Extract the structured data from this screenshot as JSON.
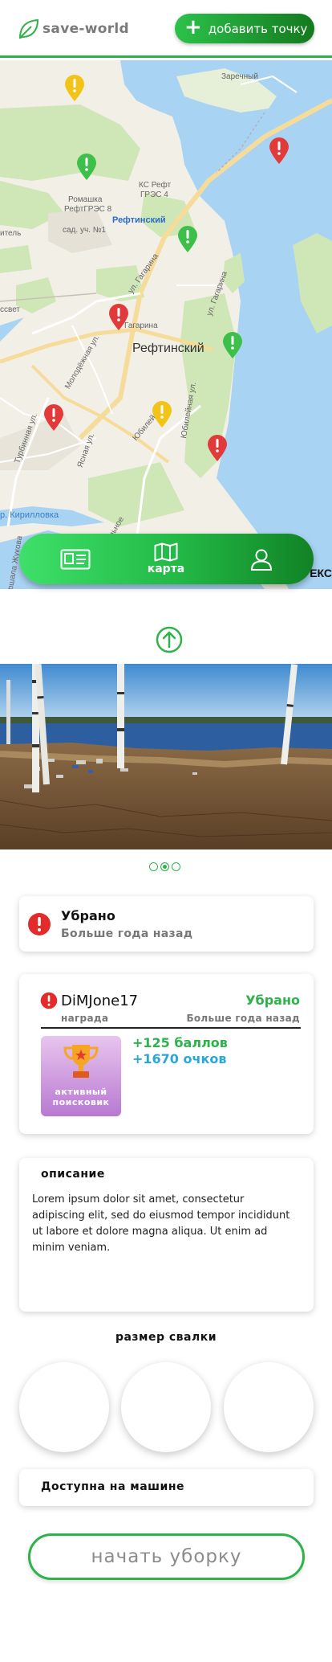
{
  "header": {
    "logo_text": "save-world",
    "add_button_label": "добавить точку"
  },
  "map": {
    "labels": {
      "zarechny": "Заречный",
      "ks_reft": "КС Рефт",
      "gres4": "ГРЭС 4",
      "romashka": "Ромашка",
      "reftgres": "РефтГРЭС 8",
      "sad": "сад. уч. №1",
      "reftinsky_small": "Рефтинский",
      "reftinsky": "Рефтинский",
      "gagarina1": "ул. Гагарина",
      "gagarina2": "Гагарина",
      "gagarina3": "ул. Гагарина",
      "gagarina4": "агарина",
      "molodezhnaya": "Молодёжная ул.",
      "turbinnaya": "Турбинная ул.",
      "yasnaya": "Ясная ул.",
      "yubileynaya": "Юбилейная ул.",
      "yubileyn2": "Юбилейн",
      "kirillovka": "р. Кирилловка",
      "zhukova": "ршала Жукова",
      "suvenir": "ивиальное",
      "svet": "ссвет",
      "itel": "итель",
      "yandex": "ЕКС"
    },
    "pins": [
      {
        "color": "#f2c318"
      },
      {
        "color": "#e23a3a"
      },
      {
        "color": "#3cc04a"
      },
      {
        "color": "#3cc04a"
      },
      {
        "color": "#e23a3a"
      },
      {
        "color": "#3cc04a"
      },
      {
        "color": "#e23a3a"
      },
      {
        "color": "#f2c318"
      },
      {
        "color": "#e23a3a"
      }
    ]
  },
  "nav": {
    "map_label": "карта",
    "id_icon": "id-card-icon",
    "map_icon": "map-icon",
    "profile_icon": "user-icon"
  },
  "status_card": {
    "title": "Убрано",
    "subtitle": "Больше года назад"
  },
  "user_card": {
    "username": "DiMJone17",
    "status": "Убрано",
    "award_label": "награда",
    "time": "Больше года назад",
    "badge_text": "активный\nпоисковик",
    "points1": "+125 баллов",
    "points2": "+1670 очков"
  },
  "description": {
    "title": "описание",
    "text": "Lorem ipsum dolor sit amet, consectetur adipiscing elit, sed do eiusmod tempor incididunt ut labore et dolore magna aliqua. Ut enim ad minim veniam."
  },
  "size_title": "размер свалки",
  "car_access": "Доступна на машине",
  "start_button": "начать уборку",
  "colors": {
    "accent": "#2db34a",
    "red": "#e23a3a",
    "blue_points": "#29a8d8"
  }
}
